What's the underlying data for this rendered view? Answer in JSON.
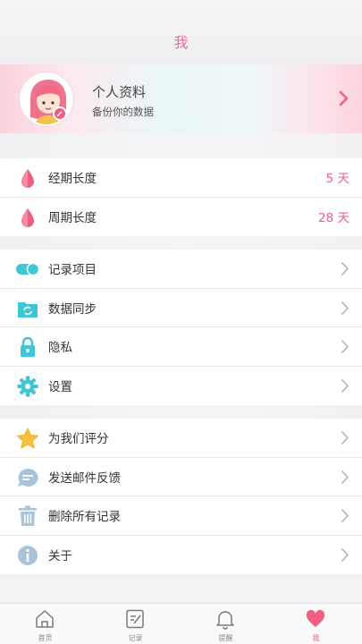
{
  "header": {
    "title": "我"
  },
  "profile": {
    "name": "个人资料",
    "subtitle": "备份你的数据"
  },
  "cycle_group": [
    {
      "label": "经期长度",
      "value": "5 天",
      "icon": "drop-icon"
    },
    {
      "label": "周期长度",
      "value": "28 天",
      "icon": "drop-icon"
    }
  ],
  "settings_group": [
    {
      "label": "记录项目",
      "icon": "toggle-icon"
    },
    {
      "label": "数据同步",
      "icon": "sync-folder-icon"
    },
    {
      "label": "隐私",
      "icon": "lock-icon"
    },
    {
      "label": "设置",
      "icon": "gear-icon"
    }
  ],
  "misc_group": [
    {
      "label": "为我们评分",
      "icon": "star-icon"
    },
    {
      "label": "发送邮件反馈",
      "icon": "chat-bubble-icon"
    },
    {
      "label": "删除所有记录",
      "icon": "trash-icon"
    },
    {
      "label": "关于",
      "icon": "info-icon"
    }
  ],
  "tabs": [
    {
      "label": "首页",
      "icon": "home-icon"
    },
    {
      "label": "记录",
      "icon": "notebook-icon"
    },
    {
      "label": "提醒",
      "icon": "bell-icon"
    },
    {
      "label": "我",
      "icon": "heart-icon"
    }
  ],
  "colors": {
    "accent": "#ef5f82",
    "teal": "#3dc6d4",
    "background": "#f2f2f4"
  }
}
